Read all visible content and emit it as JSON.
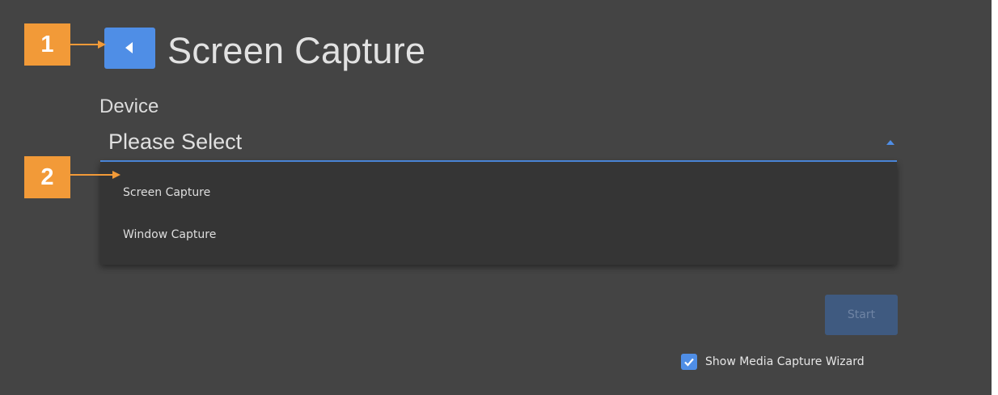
{
  "header": {
    "title": "Screen Capture",
    "back_icon": "chevron-left-icon"
  },
  "device": {
    "label": "Device",
    "placeholder": "Please Select",
    "caret_icon": "caret-up-icon",
    "options": [
      "Screen Capture",
      "Window Capture"
    ]
  },
  "actions": {
    "start_label": "Start",
    "start_enabled": false
  },
  "wizard": {
    "label": "Show Media Capture Wizard",
    "checked": true
  },
  "callouts": [
    "1",
    "2"
  ],
  "colors": {
    "background": "#444444",
    "accent": "#4f8ee6",
    "callout": "#f29a38",
    "dropdown": "#353535",
    "start_disabled": "#3f5a80"
  }
}
